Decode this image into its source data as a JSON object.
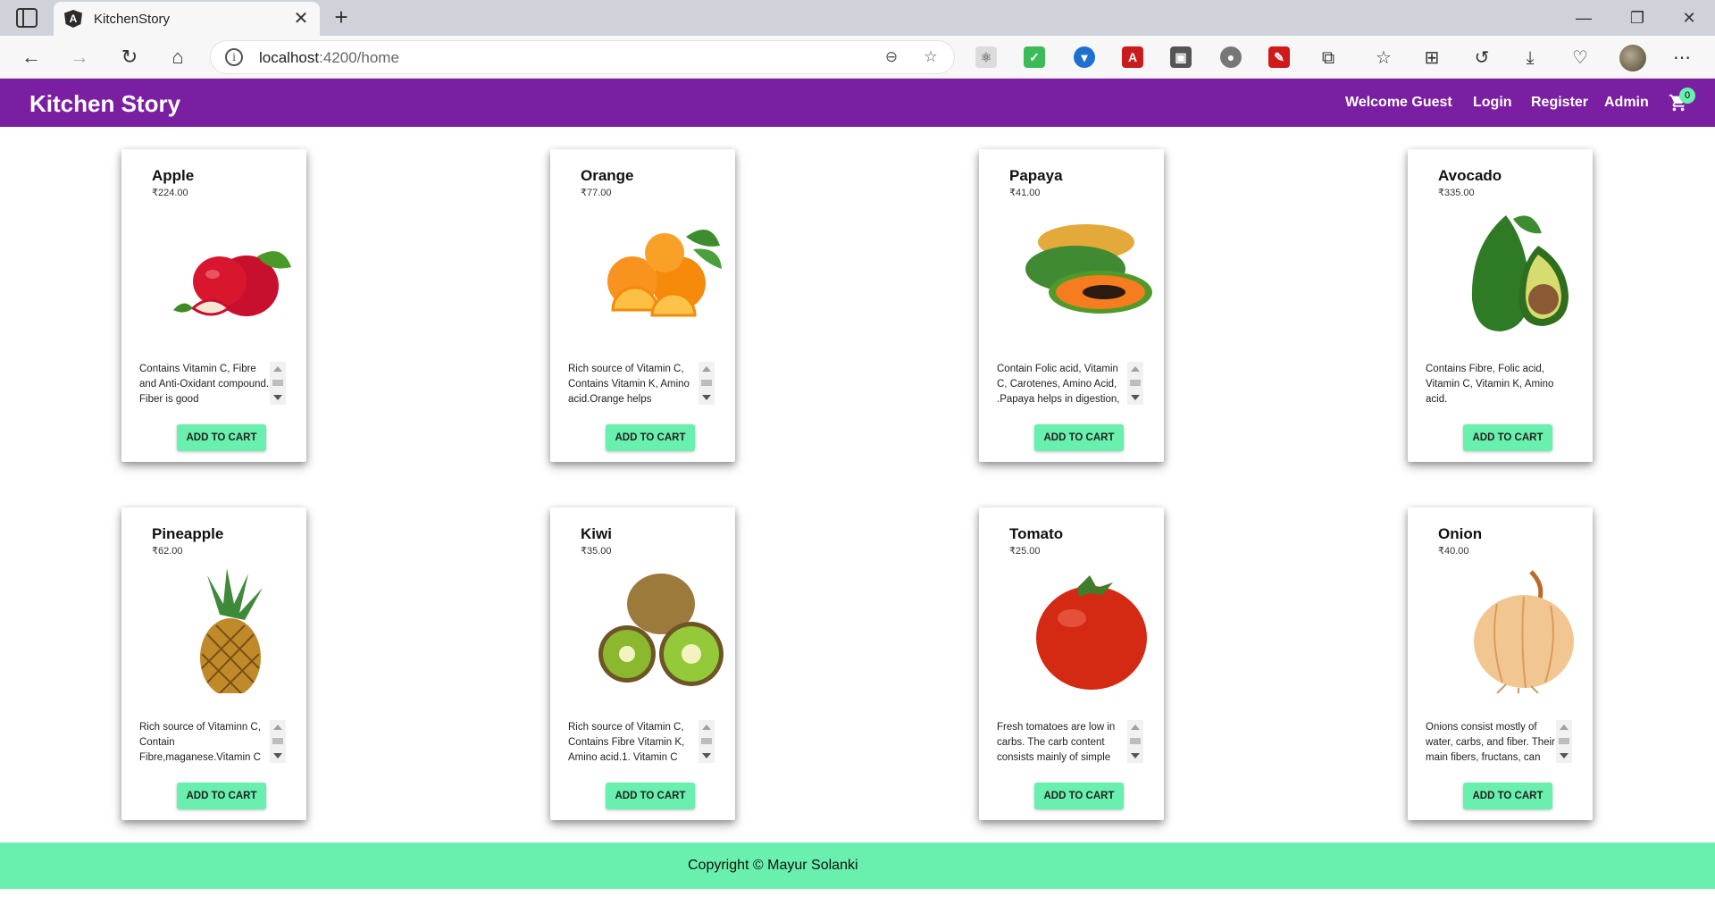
{
  "browser": {
    "tab_title": "KitchenStory",
    "tab_favicon_letter": "A",
    "url_host": "localhost",
    "url_rest": ":4200/home"
  },
  "header": {
    "brand": "Kitchen Story",
    "welcome": "Welcome Guest",
    "login": "Login",
    "register": "Register",
    "admin": "Admin",
    "cart_count": "0",
    "color": "#7b1fa2"
  },
  "products": [
    {
      "name": "Apple",
      "price": "₹224.00",
      "desc": "Contains Vitamin C, Fibre and Anti-Oxidant compound. Fiber is good",
      "btn": "ADD TO CART",
      "icon": "apple-image"
    },
    {
      "name": "Orange",
      "price": "₹77.00",
      "desc": "Rich source of Vitamin C, Contains Vitamin K, Amino acid.Orange helps",
      "btn": "ADD TO CART",
      "icon": "orange-image"
    },
    {
      "name": "Papaya",
      "price": "₹41.00",
      "desc": "Contain Folic acid, Vitamin C, Carotenes, Amino Acid, .Papaya helps in digestion,",
      "btn": "ADD TO CART",
      "icon": "papaya-image"
    },
    {
      "name": "Avocado",
      "price": "₹335.00",
      "desc": "Contains Fibre, Folic acid, Vitamin C, Vitamin K, Amino acid.",
      "btn": "ADD TO CART",
      "icon": "avocado-image"
    },
    {
      "name": "Pineapple",
      "price": "₹62.00",
      "desc": "Rich source of Vitaminn C, Contain Fibre,maganese.Vitamin C",
      "btn": "ADD TO CART",
      "icon": "pineapple-image"
    },
    {
      "name": "Kiwi",
      "price": "₹35.00",
      "desc": "Rich source of Vitamin C, Contains Fibre Vitamin K, Amino acid.1. Vitamin C",
      "btn": "ADD TO CART",
      "icon": "kiwi-image"
    },
    {
      "name": "Tomato",
      "price": "₹25.00",
      "desc": "Fresh tomatoes are low in carbs. The carb content consists mainly of simple",
      "btn": "ADD TO CART",
      "icon": "tomato-image"
    },
    {
      "name": "Onion",
      "price": "₹40.00",
      "desc": "Onions consist mostly of water, carbs, and fiber. Their main fibers, fructans, can",
      "btn": "ADD TO CART",
      "icon": "onion-image"
    }
  ],
  "footer": {
    "text": "Copyright © Mayur Solanki",
    "color": "#69f0ae"
  }
}
